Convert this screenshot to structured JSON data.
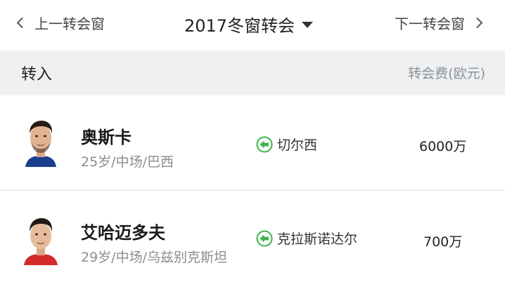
{
  "nav": {
    "prev_label": "上一转会窗",
    "season_label": "2017冬窗转会",
    "next_label": "下一转会窗"
  },
  "section": {
    "title": "转入",
    "fee_header": "转会费(欧元)"
  },
  "transfers": [
    {
      "name": "奥斯卡",
      "info": "25岁/中场/巴西",
      "from_club": "切尔西",
      "fee": "6000万"
    },
    {
      "name": "艾哈迈多夫",
      "info": "29岁/中场/乌兹别克斯坦",
      "from_club": "克拉斯诺达尔",
      "fee": "700万"
    }
  ],
  "colors": {
    "accent_green": "#3cb44a",
    "header_bg": "#eef0f2",
    "muted_text": "#8a8e92"
  },
  "icons": {
    "prev": "chevron-left-icon",
    "next": "chevron-right-icon",
    "season_dropdown": "caret-down-icon",
    "transfer_in": "arrow-left-circle-icon"
  }
}
